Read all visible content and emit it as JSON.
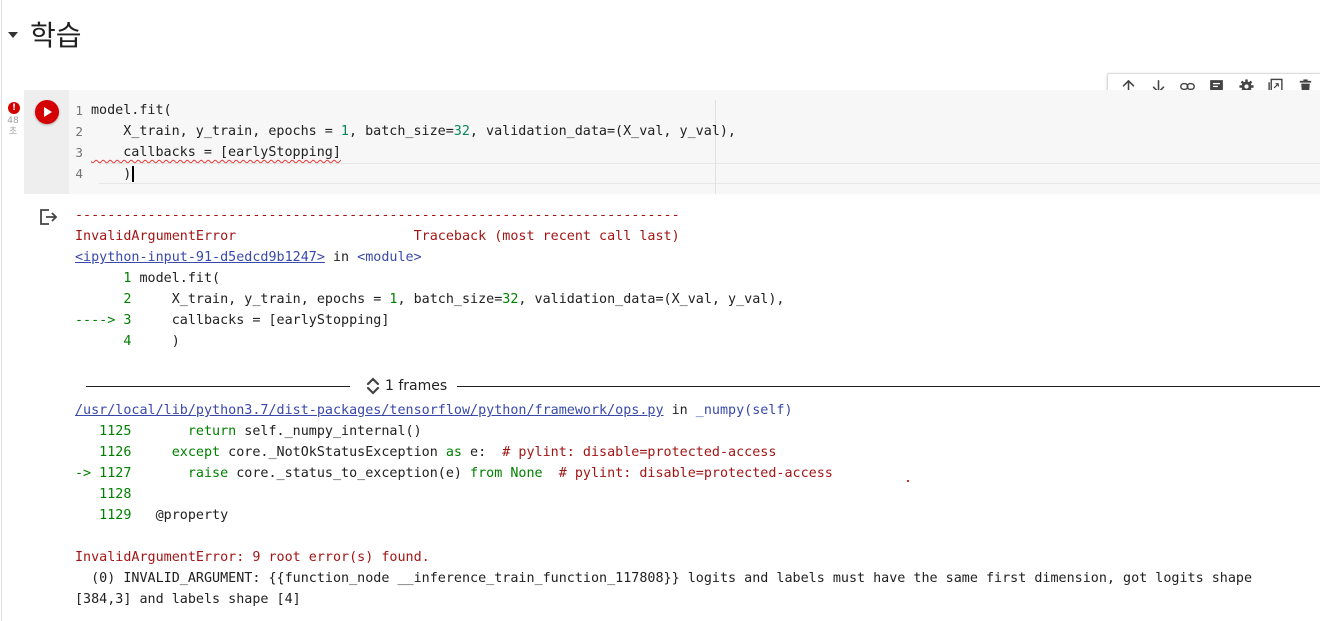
{
  "section": {
    "title": "학습"
  },
  "cell": {
    "exec_time": "48\n초",
    "error_badge": "!",
    "code_lines": [
      {
        "n": "1",
        "parts": [
          {
            "t": "model.fit(",
            "c": ""
          }
        ]
      },
      {
        "n": "2",
        "parts": [
          {
            "t": "    X_train, y_train, epochs = ",
            "c": ""
          },
          {
            "t": "1",
            "c": "num"
          },
          {
            "t": ", batch_size=",
            "c": ""
          },
          {
            "t": "32",
            "c": "num"
          },
          {
            "t": ", validation_data=(X_val, y_val),",
            "c": ""
          }
        ]
      },
      {
        "n": "3",
        "parts": [
          {
            "t": "    callbacks = [earlyStopping]",
            "c": ""
          }
        ]
      },
      {
        "n": "4",
        "parts": [
          {
            "t": "    )",
            "c": ""
          }
        ]
      }
    ]
  },
  "toolbar": {
    "buttons": [
      "move-up-icon",
      "move-down-icon",
      "link-icon",
      "comment-icon",
      "settings-icon",
      "mirror-cell-icon",
      "delete-icon"
    ]
  },
  "output": {
    "dash_line": "---------------------------------------------------------------------------",
    "error_name": "InvalidArgumentError",
    "traceback_label": "Traceback (most recent call last)",
    "ipython_link": "<ipython-input-91-d5edcd9b1247>",
    "in_text": " in ",
    "module_text": "<module>",
    "ctx1": [
      {
        "prefix": "      ",
        "n": "1",
        "code": " model.fit("
      },
      {
        "prefix": "      ",
        "n": "2",
        "code": "     X_train, y_train, epochs = 1, batch_size=32, validation_data=(X_val, y_val),"
      },
      {
        "prefix": "----> ",
        "n": "3",
        "code": "     callbacks = [earlyStopping]"
      },
      {
        "prefix": "      ",
        "n": "4",
        "code": "     )"
      }
    ],
    "frames_label": "1 frames",
    "file_link": "/usr/local/lib/python3.7/dist-packages/tensorflow/python/framework/ops.py",
    "func_text": "_numpy(self)",
    "ctx2": [
      {
        "prefix": "   ",
        "n": "1125",
        "code": "       return self._numpy_internal()"
      },
      {
        "prefix": "   ",
        "n": "1126",
        "code": "     except core._NotOkStatusException as e:  # pylint: disable=protected-access"
      },
      {
        "prefix": "-> ",
        "n": "1127",
        "code": "       raise core._status_to_exception(e) from None  # pylint: disable=protected-access"
      },
      {
        "prefix": "   ",
        "n": "1128",
        "code": ""
      },
      {
        "prefix": "   ",
        "n": "1129",
        "code": "   @property"
      }
    ],
    "summary": "InvalidArgumentError: 9 root error(s) found.",
    "detail": "  (0) INVALID_ARGUMENT: {{function_node __inference_train_function_117808}} logits and labels must have the same first dimension, got logits shape [384,3] and labels shape [4]"
  }
}
